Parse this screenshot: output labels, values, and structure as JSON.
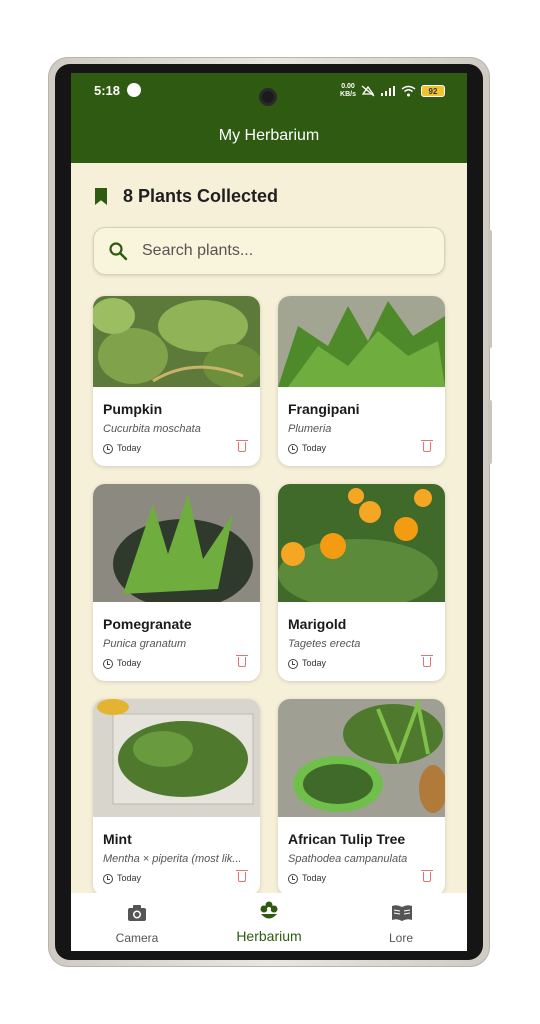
{
  "status_bar": {
    "time": "5:18",
    "net_speed_value": "0.00",
    "net_speed_unit": "KB/s",
    "battery": "92"
  },
  "header": {
    "title": "My Herbarium"
  },
  "collection": {
    "count_label": "8 Plants Collected"
  },
  "search": {
    "placeholder": "Search plants..."
  },
  "plants": [
    {
      "name": "Pumpkin",
      "scientific": "Cucurbita moschata",
      "date": "Today"
    },
    {
      "name": "Frangipani",
      "scientific": "Plumeria",
      "date": "Today"
    },
    {
      "name": "Pomegranate",
      "scientific": "Punica granatum",
      "date": "Today"
    },
    {
      "name": "Marigold",
      "scientific": "Tagetes erecta",
      "date": "Today"
    },
    {
      "name": "Mint",
      "scientific": "Mentha × piperita (most lik...",
      "date": "Today"
    },
    {
      "name": "African Tulip Tree",
      "scientific": "Spathodea campanulata",
      "date": "Today"
    }
  ],
  "bottom_nav": {
    "camera": "Camera",
    "herbarium": "Herbarium",
    "lore": "Lore"
  },
  "colors": {
    "primary": "#2e5a12",
    "background": "#f6f0d9",
    "delete": "#e57373"
  },
  "icons": [
    "bookmark-icon",
    "search-icon",
    "clock-icon",
    "delete-icon",
    "camera-icon",
    "flower-icon",
    "book-icon"
  ]
}
